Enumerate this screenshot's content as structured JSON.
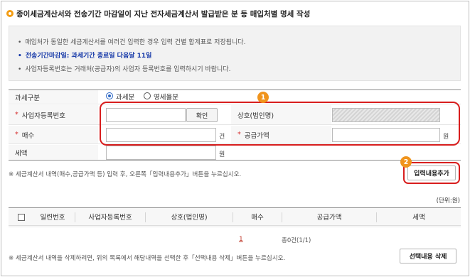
{
  "title": "종이세금계산서와 전송기간 마감일이 지난 전자세금계산서 발급받은 분 등 매입처별 명세 작성",
  "info": {
    "line1": "매입처가 동일한 세금계산서를 여러건 입력한 경우 입력 건별 합계표로 저장됩니다.",
    "line2": "전송기간마감일: 과세기간 종료일 다음달 11일",
    "line3": "사업자등록번호는 거래처(공급자)의 사업자 등록번호를 입력하시기 바랍니다.",
    "bullet": "•",
    "bullet_highlight": "•"
  },
  "form": {
    "tax_type_label": "과세구분",
    "tax_type_options": [
      "과세분",
      "영세율분"
    ],
    "tax_type_selected": "과세분",
    "required_mark": "*",
    "bizno_label": "사업자등록번호",
    "bizno_value": "",
    "confirm_button": "확인",
    "company_label": "상호(법인명)",
    "company_value": "",
    "count_label": "매수",
    "count_value": "",
    "count_unit": "건",
    "supply_label": "공급가액",
    "supply_value": "",
    "supply_unit": "원",
    "tax_label": "세액",
    "tax_value": "",
    "tax_unit": "원"
  },
  "notice_add": "※ 세금계산서 내역(매수,공급가액 등) 입력 후, 오른쪽「입력내용추가」버튼을 누르십시오.",
  "add_button": "입력내용추가",
  "unit_note": "(단위:원)",
  "table": {
    "columns": [
      "일련번호",
      "사업자등록번호",
      "상호(법인명)",
      "매수",
      "공급가액",
      "세액"
    ]
  },
  "pagination": {
    "page": "1",
    "total": "총0건(1/1)"
  },
  "notice_delete": "※ 세금계산서 내역을 삭제하려면, 위의 목록에서 해당내역을 선택한 후「선택내용 삭제」버튼을 누르십시오.",
  "delete_button": "선택내용 삭제",
  "annotations": [
    "1",
    "2"
  ],
  "colors": {
    "accent_orange": "#f0941d",
    "highlight_red": "#d81e1e",
    "link_blue": "#1538a8",
    "required_red": "#d63131"
  }
}
